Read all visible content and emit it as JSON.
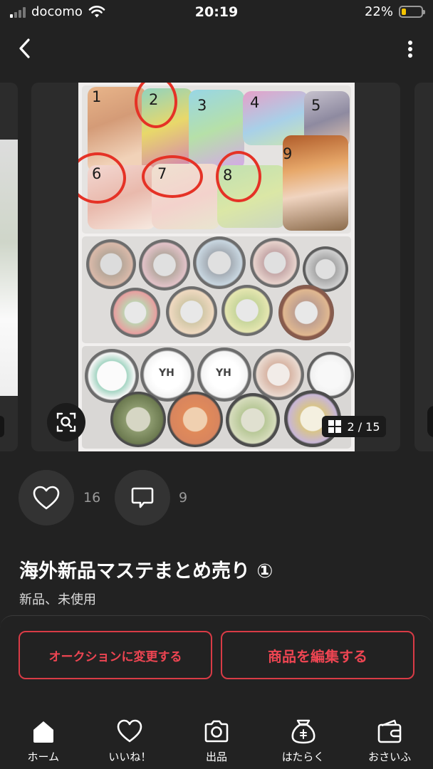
{
  "status_bar": {
    "carrier": "docomo",
    "time": "20:19",
    "battery": "22%",
    "battery_level": 0.22
  },
  "image": {
    "counter": "2 / 15",
    "tape_numbers": [
      "1",
      "2",
      "3",
      "4",
      "5",
      "6",
      "7",
      "8",
      "9"
    ],
    "circled_numbers": [
      "2",
      "6",
      "7",
      "8"
    ],
    "label_texts": [
      "YH",
      "YH"
    ]
  },
  "reactions": {
    "likes": "16",
    "comments": "9"
  },
  "item": {
    "title": "海外新品マステまとめ売り ①",
    "condition": "新品、未使用"
  },
  "actions": {
    "auction": "オークションに変更する",
    "edit": "商品を編集する"
  },
  "tabs": [
    {
      "label": "ホーム",
      "icon": "home-icon"
    },
    {
      "label": "いいね！",
      "icon": "heart-icon"
    },
    {
      "label": "出品",
      "icon": "camera-icon"
    },
    {
      "label": "はたらく",
      "icon": "money-bag-icon"
    },
    {
      "label": "おさいふ",
      "icon": "wallet-icon"
    }
  ],
  "colors": {
    "background": "#222222",
    "accent_red": "#ee4552",
    "battery_yellow": "#f5c400"
  }
}
